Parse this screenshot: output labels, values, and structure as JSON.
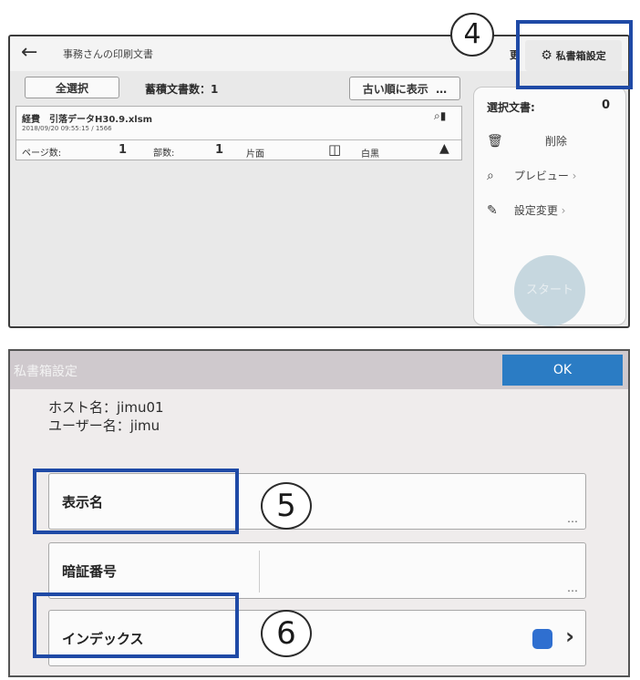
{
  "top": {
    "title": "事務さんの印刷文書",
    "select_all": "全選択",
    "stored_count_label": "蓄積文書数：1",
    "sort_button": "古い順に表示",
    "partial_header": "更",
    "doc": {
      "name": "経費　引落データH30.9.xlsm",
      "datetime": "2018/09/20 09:55:15 / 1566",
      "pages_label": "ページ数:",
      "pages_value": "1",
      "copies_label": "部数:",
      "copies_value": "1",
      "duplex_label": "片面",
      "color_label": "白黒"
    },
    "side": {
      "selected_label": "選択文書:",
      "selected_value": "0",
      "delete": "削除",
      "preview": "プレビュー",
      "settings": "設定変更",
      "start": "スタート"
    },
    "private_box_button": "私書箱設定",
    "callout": "④"
  },
  "bottom": {
    "title": "私書箱設定",
    "ok": "OK",
    "host": "ホスト名：jimu01",
    "user": "ユーザー名：jimu",
    "fields": {
      "display_name": "表示名",
      "password": "暗証番号",
      "index": "インデックス"
    },
    "callout5": "⑤",
    "callout6": "⑥",
    "index_color": "#2f6fd0"
  },
  "icons": {
    "back": "back-arrow-icon",
    "gear": "gear-icon",
    "trash": "trash-icon",
    "preview": "preview-icon",
    "edit": "edit-icon",
    "chevron": "chevron-right-icon"
  }
}
